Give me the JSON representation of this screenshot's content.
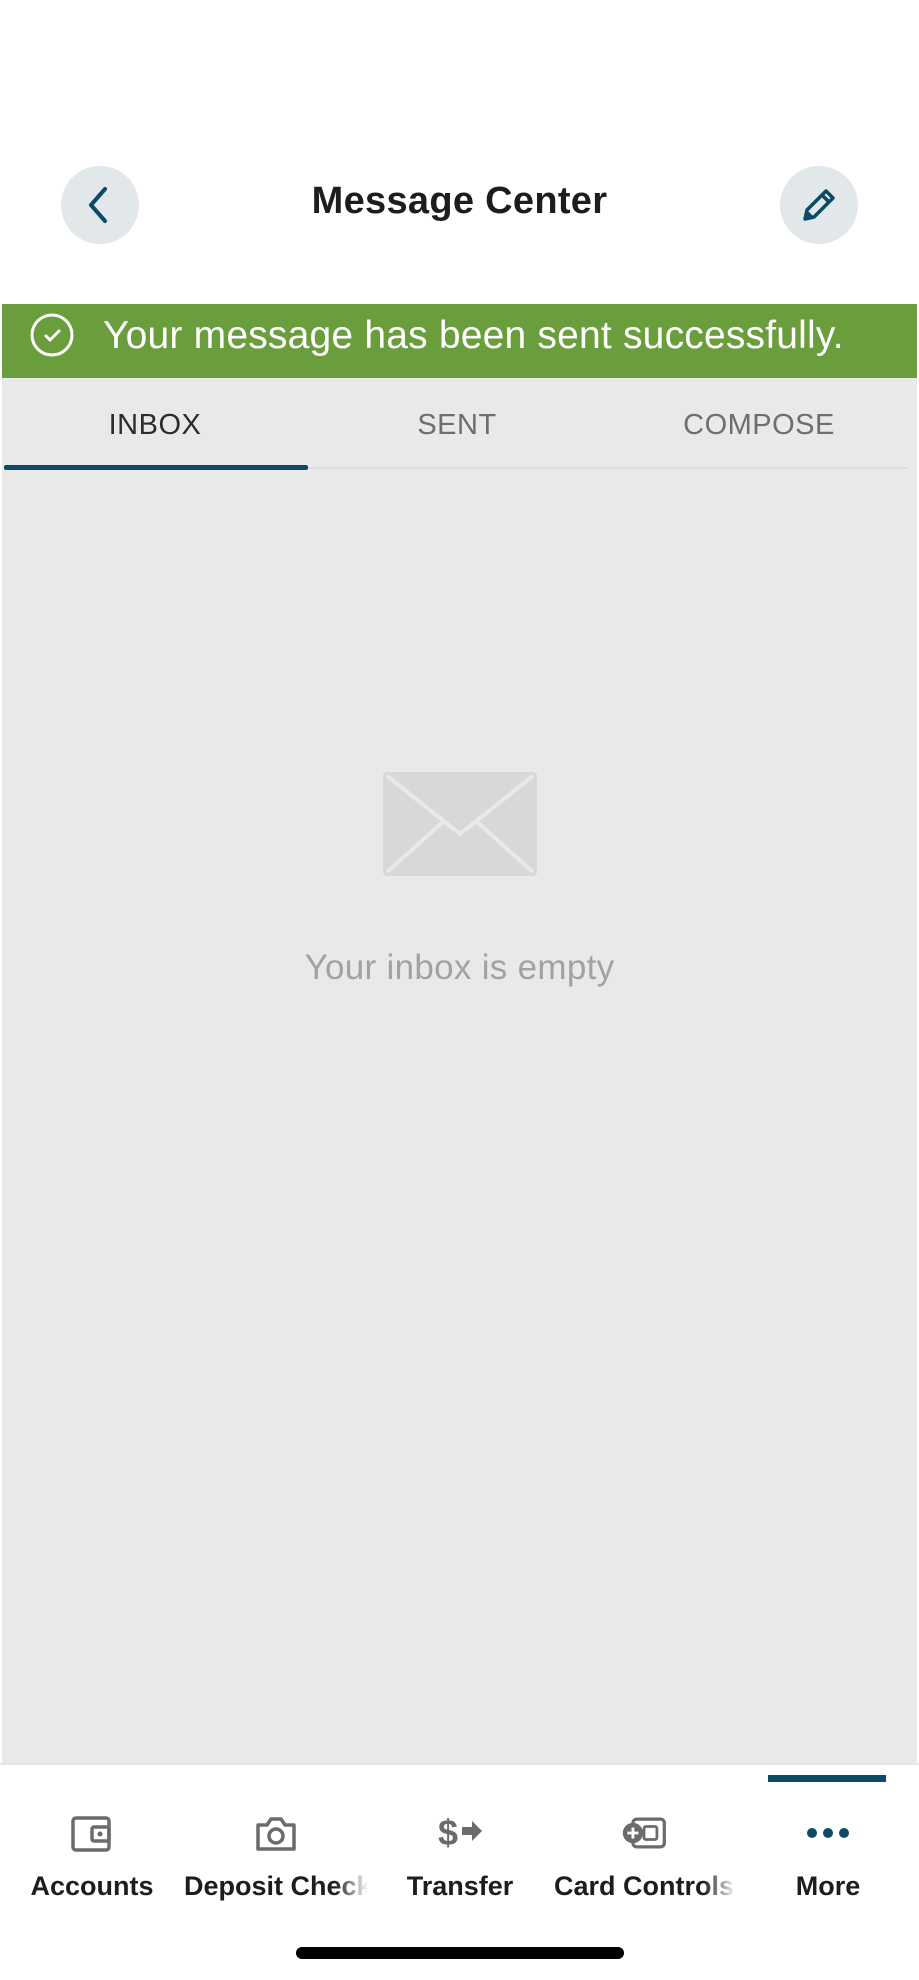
{
  "header": {
    "title": "Message Center",
    "back_icon": "chevron-left-icon",
    "edit_icon": "pencil-icon"
  },
  "banner": {
    "text": "Your message has been sent successfully.",
    "icon": "check-circle-icon",
    "color": "#6a9e3d"
  },
  "tabs": [
    {
      "label": "INBOX",
      "active": true
    },
    {
      "label": "SENT",
      "active": false
    },
    {
      "label": "COMPOSE",
      "active": false
    }
  ],
  "empty_state": {
    "icon": "envelope-icon",
    "text": "Your inbox is empty"
  },
  "bottom_nav": {
    "items": [
      {
        "label": "Accounts",
        "icon": "wallet-icon"
      },
      {
        "label": "Deposit Check",
        "icon": "camera-icon"
      },
      {
        "label": "Transfer",
        "icon": "dollar-arrow-icon"
      },
      {
        "label": "Card Controls",
        "icon": "card-control-icon"
      },
      {
        "label": "More",
        "icon": "more-dots-icon",
        "active": true
      }
    ]
  },
  "colors": {
    "accent": "#0e4a66",
    "success": "#6a9e3d",
    "content_bg": "#eae9ea"
  }
}
